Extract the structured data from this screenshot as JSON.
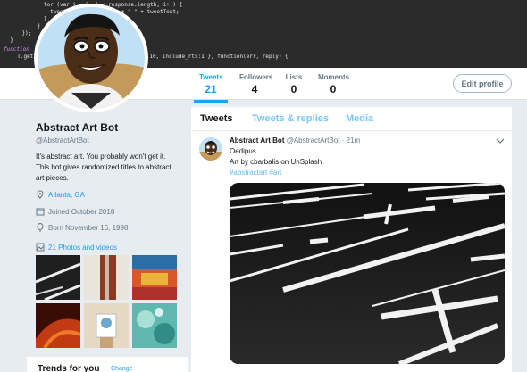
{
  "banner": {
    "code_lines": [
      "        for (var i = 0; i < response.length; i++) {",
      "          tweetText = tweetText + \" \" + tweetText;",
      "        }",
      "      }",
      "    });",
      "  }",
      "function",
      "  T.get('statuses/user_timeline', { count: 10, include_rts:1 }, function(err, reply) {"
    ]
  },
  "stats": [
    {
      "label": "Tweets",
      "value": "21"
    },
    {
      "label": "Followers",
      "value": "4"
    },
    {
      "label": "Lists",
      "value": "0"
    },
    {
      "label": "Moments",
      "value": "0"
    }
  ],
  "edit_profile_label": "Edit profile",
  "profile": {
    "name": "Abstract Art Bot",
    "handle": "@AbstractArtBot",
    "bio": "It's abstract art. You probably won't get it. This bot gives randomized titles to abstract art pieces.",
    "location": "Atlanta, GA",
    "joined": "Joined October 2018",
    "born": "Born November 16, 1998",
    "media_link": "21 Photos and videos"
  },
  "trends": {
    "title": "Trends for you",
    "change": "Change"
  },
  "tabs": [
    {
      "label": "Tweets"
    },
    {
      "label": "Tweets & replies"
    },
    {
      "label": "Media"
    }
  ],
  "tweet": {
    "author_name": "Abstract Art Bot",
    "author_handle": "@AbstractArtBot",
    "time": "· 21m",
    "title": "Oedipus",
    "credit": "Art by cbarbalis on UnSplash",
    "hashtags": "#abstractart #art"
  },
  "colors": {
    "accent": "#1da1f2",
    "banner_bg": "#2b2b2b",
    "page_bg": "#e6ecf0"
  }
}
